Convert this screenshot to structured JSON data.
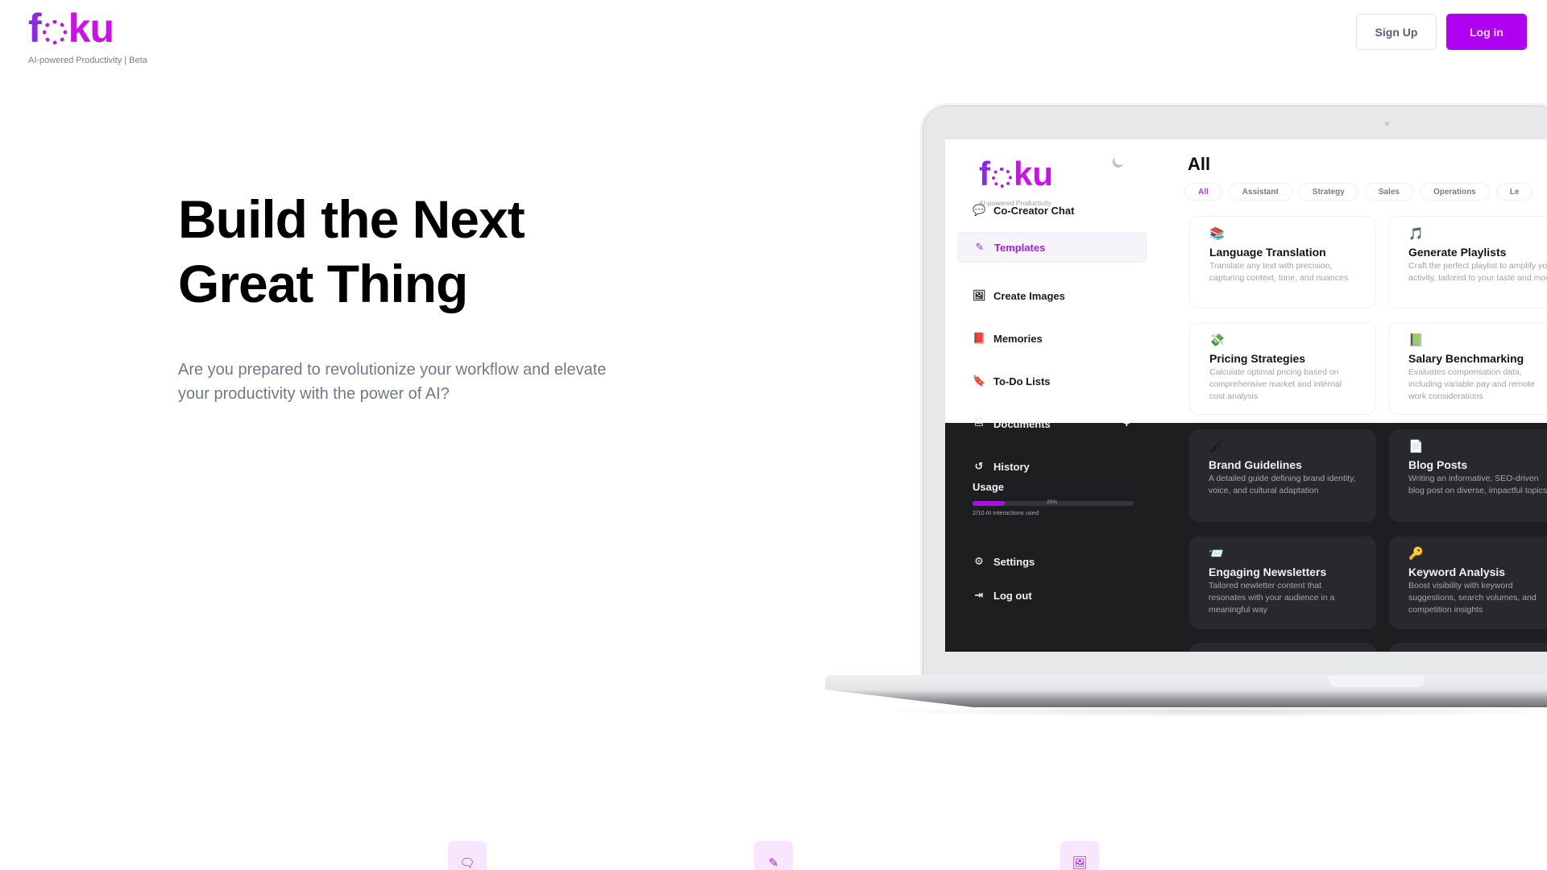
{
  "header": {
    "logo": {
      "f": "f",
      "o": "o",
      "ku": "ku"
    },
    "tagline": "AI-powered Productivity | Beta",
    "signup_label": "Sign Up",
    "login_label": "Log in"
  },
  "hero": {
    "title_line1": "Build the Next",
    "title_line2": "Great Thing",
    "subtitle": "Are you prepared to revolutionize your workflow and elevate your productivity with the power of AI?"
  },
  "app": {
    "logo": {
      "f": "f",
      "o": "o",
      "ku": "ku"
    },
    "tagline": "AI-powered Productivity",
    "theme_toggle_icon": "moon-icon",
    "nav": [
      {
        "label": "Co-Creator Chat",
        "icon": "comments-icon",
        "glyph": "💬",
        "active": false
      },
      {
        "label": "Templates",
        "icon": "edit-icon",
        "glyph": "✎",
        "active": true
      },
      {
        "label": "Create Images",
        "icon": "image-icon",
        "glyph": "🖼",
        "active": false
      },
      {
        "label": "Memories",
        "icon": "book-icon",
        "glyph": "📕",
        "active": false
      },
      {
        "label": "To-Do Lists",
        "icon": "bookmark-icon",
        "glyph": "🔖",
        "active": false
      },
      {
        "label": "Documents",
        "icon": "document-icon",
        "glyph": "🗎",
        "active": false
      },
      {
        "label": "History",
        "icon": "history-icon",
        "glyph": "↺",
        "active": false
      },
      {
        "label": "Settings",
        "icon": "cogs-icon",
        "glyph": "⚙",
        "active": false
      },
      {
        "label": "Log out",
        "icon": "logout-icon",
        "glyph": "⇥",
        "active": false
      }
    ],
    "documents_add": "+",
    "usage": {
      "title": "Usage",
      "percent": 20,
      "percent_label": "20%",
      "subtitle": "2/10 AI interactions used"
    },
    "main": {
      "title": "All",
      "chips": [
        {
          "label": "All",
          "active": true
        },
        {
          "label": "Assistant",
          "active": false
        },
        {
          "label": "Strategy",
          "active": false
        },
        {
          "label": "Sales",
          "active": false
        },
        {
          "label": "Operations",
          "active": false
        },
        {
          "label": "Le",
          "active": false
        }
      ],
      "cards": [
        {
          "emoji": "📚",
          "title": "Language Translation",
          "desc": "Translate any text with precision, capturing context, tone, and nuances"
        },
        {
          "emoji": "🎵",
          "title": "Generate Playlists",
          "desc": "Craft the perfect playlist to amplify your activity, tailored to your taste and mood"
        },
        {
          "emoji": "💸",
          "title": "Pricing Strategies",
          "desc": "Calculate optimal pricing based on comprehensive market and internal cost analysis"
        },
        {
          "emoji": "📗",
          "title": "Salary Benchmarking",
          "desc": "Evaluates compensation data, including variable pay and remote work considerations"
        },
        {
          "emoji": "🖌",
          "title": "Brand Guidelines",
          "desc": "A detailed guide defining brand identity, voice, and cultural adaptation"
        },
        {
          "emoji": "📄",
          "title": "Blog Posts",
          "desc": "Writing an informative, SEO-driven blog post on diverse, impactful topics"
        },
        {
          "emoji": "📨",
          "title": "Engaging Newsletters",
          "desc": "Tailored newletter content that resonates with your audience in a meaningful way"
        },
        {
          "emoji": "🔑",
          "title": "Keyword Analysis",
          "desc": "Boost visibility with keyword suggestions, search volumes, and competition insights"
        }
      ]
    }
  },
  "features": [
    {
      "icon": "comments-icon",
      "glyph": "🗨"
    },
    {
      "icon": "edit-icon",
      "glyph": "✎"
    },
    {
      "icon": "image-icon",
      "glyph": "🖼"
    }
  ],
  "colors": {
    "brand": "#b000f2",
    "brand_text": "#a024d6",
    "dark_panel": "#1d1e20",
    "feature_bg": "#f7e6fd"
  }
}
